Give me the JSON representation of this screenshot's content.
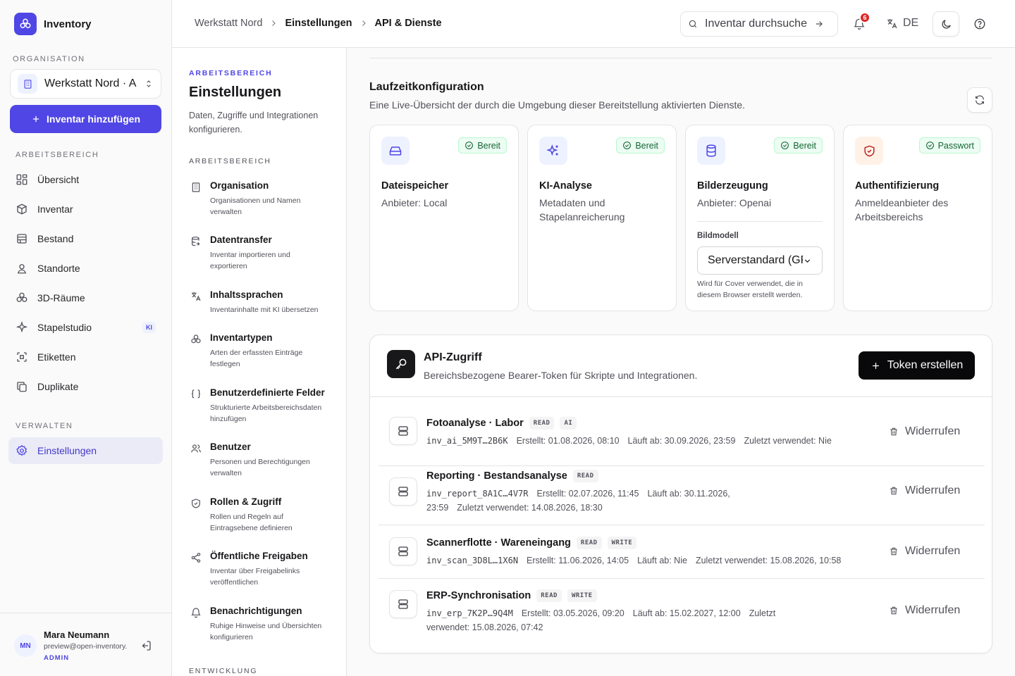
{
  "app": {
    "name": "Inventory"
  },
  "sidebar": {
    "org_label": "ORGANISATION",
    "org_name": "Werkstatt Nord · Ausleihe",
    "add_button": "Inventar hinzufügen",
    "workspace_label": "ARBEITSBEREICH",
    "items": [
      {
        "label": "Übersicht",
        "icon": "dashboard-icon"
      },
      {
        "label": "Inventar",
        "icon": "box-icon"
      },
      {
        "label": "Bestand",
        "icon": "stock-icon"
      },
      {
        "label": "Standorte",
        "icon": "location-icon"
      },
      {
        "label": "3D-Räume",
        "icon": "cube-icon"
      },
      {
        "label": "Stapelstudio",
        "icon": "sparkle-icon",
        "badge": "KI"
      },
      {
        "label": "Etiketten",
        "icon": "qr-icon"
      },
      {
        "label": "Duplikate",
        "icon": "copy-icon"
      }
    ],
    "manage_label": "VERWALTEN",
    "settings_label": "Einstellungen",
    "user": {
      "initials": "MN",
      "name": "Mara Neumann",
      "email": "preview@open-inventory.app",
      "role": "ADMIN"
    }
  },
  "topbar": {
    "breadcrumb": [
      "Werkstatt Nord",
      "Einstellungen",
      "API & Dienste"
    ],
    "search_placeholder": "Inventar durchsuchen",
    "notification_count": "6",
    "language": "DE"
  },
  "subnav": {
    "kicker": "ARBEITSBEREICH",
    "title": "Einstellungen",
    "description": "Daten, Zugriffe und Integrationen konfigurieren.",
    "section_label": "ARBEITSBEREICH",
    "items": [
      {
        "title": "Organisation",
        "desc": "Organisationen und Namen verwalten",
        "icon": "building-icon"
      },
      {
        "title": "Datentransfer",
        "desc": "Inventar importieren und exportieren",
        "icon": "database-transfer-icon"
      },
      {
        "title": "Inhaltssprachen",
        "desc": "Inventarinhalte mit KI übersetzen",
        "icon": "translate-icon"
      },
      {
        "title": "Inventartypen",
        "desc": "Arten der erfassten Einträge festlegen",
        "icon": "shapes-icon"
      },
      {
        "title": "Benutzerdefinierte Felder",
        "desc": "Strukturierte Arbeitsbereichsdaten hinzufügen",
        "icon": "braces-icon"
      },
      {
        "title": "Benutzer",
        "desc": "Personen und Berechtigungen verwalten",
        "icon": "users-icon"
      },
      {
        "title": "Rollen & Zugriff",
        "desc": "Rollen und Regeln auf Eintragsebene definieren",
        "icon": "shield-icon"
      },
      {
        "title": "Öffentliche Freigaben",
        "desc": "Inventar über Freigabelinks veröffentlichen",
        "icon": "share-icon"
      },
      {
        "title": "Benachrichtigungen",
        "desc": "Ruhige Hinweise und Übersichten konfigurieren",
        "icon": "bell-icon"
      }
    ],
    "section2_label": "ENTWICKLUNG"
  },
  "runtime": {
    "title": "Laufzeitkonfiguration",
    "description": "Eine Live-Übersicht der durch die Umgebung dieser Bereitstellung aktivierten Dienste.",
    "services": [
      {
        "name": "Dateispeicher",
        "status": "Bereit",
        "desc": "Anbieter: Local",
        "icon": "drive-icon"
      },
      {
        "name": "KI-Analyse",
        "status": "Bereit",
        "desc": "Metadaten und Stapelanreicherung",
        "icon": "sparkle-icon"
      },
      {
        "name": "Bilderzeugung",
        "status": "Bereit",
        "desc": "Anbieter: Openai",
        "icon": "database-icon",
        "field_label": "Bildmodell",
        "select_value": "Serverstandard (GPT Image)",
        "hint": "Wird für Cover verwendet, die in diesem Browser erstellt werden."
      },
      {
        "name": "Authentifizierung",
        "status": "Passwort",
        "desc": "Anmeldeanbieter des Arbeitsbereichs",
        "icon": "shield-icon"
      }
    ],
    "colors": {
      "status_bg": "#ecfdf3",
      "status_text": "#166534",
      "accent": "#4f46e5"
    }
  },
  "api": {
    "title": "API-Zugriff",
    "description": "Bereichsbezogene Bearer-Token für Skripte und Integrationen.",
    "create_button": "Token erstellen",
    "revoke_label": "Widerrufen",
    "tokens": [
      {
        "name": "Fotoanalyse · Labor",
        "scopes": [
          "READ",
          "AI"
        ],
        "key": "inv_ai_5M9T…2B6K",
        "created": "Erstellt: 01.08.2026, 08:10",
        "expires": "Läuft ab: 30.09.2026, 23:59",
        "last_used": "Zuletzt verwendet: Nie"
      },
      {
        "name": "Reporting · Bestandsanalyse",
        "scopes": [
          "READ"
        ],
        "key": "inv_report_8A1C…4V7R",
        "created": "Erstellt: 02.07.2026, 11:45",
        "expires": "Läuft ab: 30.11.2026, 23:59",
        "last_used": "Zuletzt verwendet: 14.08.2026, 18:30"
      },
      {
        "name": "Scannerflotte · Wareneingang",
        "scopes": [
          "READ",
          "WRITE"
        ],
        "key": "inv_scan_3D8L…1X6N",
        "created": "Erstellt: 11.06.2026, 14:05",
        "expires": "Läuft ab: Nie",
        "last_used": "Zuletzt verwendet: 15.08.2026, 10:58"
      },
      {
        "name": "ERP-Synchronisation",
        "scopes": [
          "READ",
          "WRITE"
        ],
        "key": "inv_erp_7K2P…9Q4M",
        "created": "Erstellt: 03.05.2026, 09:20",
        "expires": "Läuft ab: 15.02.2027, 12:00",
        "last_used": "Zuletzt verwendet: 15.08.2026, 07:42"
      }
    ]
  }
}
